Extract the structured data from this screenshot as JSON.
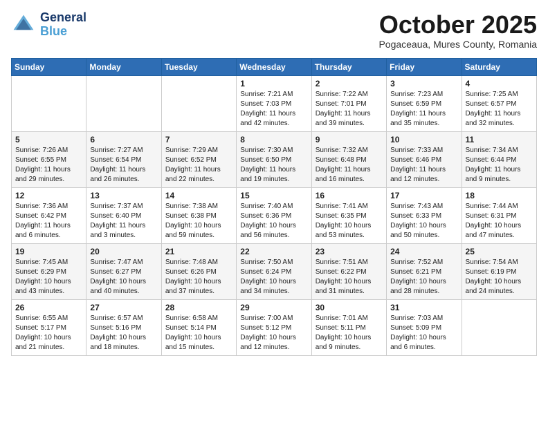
{
  "header": {
    "logo_general": "General",
    "logo_blue": "Blue",
    "month_title": "October 2025",
    "location": "Pogaceaua, Mures County, Romania"
  },
  "days_of_week": [
    "Sunday",
    "Monday",
    "Tuesday",
    "Wednesday",
    "Thursday",
    "Friday",
    "Saturday"
  ],
  "weeks": [
    [
      {
        "day": "",
        "info": ""
      },
      {
        "day": "",
        "info": ""
      },
      {
        "day": "",
        "info": ""
      },
      {
        "day": "1",
        "info": "Sunrise: 7:21 AM\nSunset: 7:03 PM\nDaylight: 11 hours\nand 42 minutes."
      },
      {
        "day": "2",
        "info": "Sunrise: 7:22 AM\nSunset: 7:01 PM\nDaylight: 11 hours\nand 39 minutes."
      },
      {
        "day": "3",
        "info": "Sunrise: 7:23 AM\nSunset: 6:59 PM\nDaylight: 11 hours\nand 35 minutes."
      },
      {
        "day": "4",
        "info": "Sunrise: 7:25 AM\nSunset: 6:57 PM\nDaylight: 11 hours\nand 32 minutes."
      }
    ],
    [
      {
        "day": "5",
        "info": "Sunrise: 7:26 AM\nSunset: 6:55 PM\nDaylight: 11 hours\nand 29 minutes."
      },
      {
        "day": "6",
        "info": "Sunrise: 7:27 AM\nSunset: 6:54 PM\nDaylight: 11 hours\nand 26 minutes."
      },
      {
        "day": "7",
        "info": "Sunrise: 7:29 AM\nSunset: 6:52 PM\nDaylight: 11 hours\nand 22 minutes."
      },
      {
        "day": "8",
        "info": "Sunrise: 7:30 AM\nSunset: 6:50 PM\nDaylight: 11 hours\nand 19 minutes."
      },
      {
        "day": "9",
        "info": "Sunrise: 7:32 AM\nSunset: 6:48 PM\nDaylight: 11 hours\nand 16 minutes."
      },
      {
        "day": "10",
        "info": "Sunrise: 7:33 AM\nSunset: 6:46 PM\nDaylight: 11 hours\nand 12 minutes."
      },
      {
        "day": "11",
        "info": "Sunrise: 7:34 AM\nSunset: 6:44 PM\nDaylight: 11 hours\nand 9 minutes."
      }
    ],
    [
      {
        "day": "12",
        "info": "Sunrise: 7:36 AM\nSunset: 6:42 PM\nDaylight: 11 hours\nand 6 minutes."
      },
      {
        "day": "13",
        "info": "Sunrise: 7:37 AM\nSunset: 6:40 PM\nDaylight: 11 hours\nand 3 minutes."
      },
      {
        "day": "14",
        "info": "Sunrise: 7:38 AM\nSunset: 6:38 PM\nDaylight: 10 hours\nand 59 minutes."
      },
      {
        "day": "15",
        "info": "Sunrise: 7:40 AM\nSunset: 6:36 PM\nDaylight: 10 hours\nand 56 minutes."
      },
      {
        "day": "16",
        "info": "Sunrise: 7:41 AM\nSunset: 6:35 PM\nDaylight: 10 hours\nand 53 minutes."
      },
      {
        "day": "17",
        "info": "Sunrise: 7:43 AM\nSunset: 6:33 PM\nDaylight: 10 hours\nand 50 minutes."
      },
      {
        "day": "18",
        "info": "Sunrise: 7:44 AM\nSunset: 6:31 PM\nDaylight: 10 hours\nand 47 minutes."
      }
    ],
    [
      {
        "day": "19",
        "info": "Sunrise: 7:45 AM\nSunset: 6:29 PM\nDaylight: 10 hours\nand 43 minutes."
      },
      {
        "day": "20",
        "info": "Sunrise: 7:47 AM\nSunset: 6:27 PM\nDaylight: 10 hours\nand 40 minutes."
      },
      {
        "day": "21",
        "info": "Sunrise: 7:48 AM\nSunset: 6:26 PM\nDaylight: 10 hours\nand 37 minutes."
      },
      {
        "day": "22",
        "info": "Sunrise: 7:50 AM\nSunset: 6:24 PM\nDaylight: 10 hours\nand 34 minutes."
      },
      {
        "day": "23",
        "info": "Sunrise: 7:51 AM\nSunset: 6:22 PM\nDaylight: 10 hours\nand 31 minutes."
      },
      {
        "day": "24",
        "info": "Sunrise: 7:52 AM\nSunset: 6:21 PM\nDaylight: 10 hours\nand 28 minutes."
      },
      {
        "day": "25",
        "info": "Sunrise: 7:54 AM\nSunset: 6:19 PM\nDaylight: 10 hours\nand 24 minutes."
      }
    ],
    [
      {
        "day": "26",
        "info": "Sunrise: 6:55 AM\nSunset: 5:17 PM\nDaylight: 10 hours\nand 21 minutes."
      },
      {
        "day": "27",
        "info": "Sunrise: 6:57 AM\nSunset: 5:16 PM\nDaylight: 10 hours\nand 18 minutes."
      },
      {
        "day": "28",
        "info": "Sunrise: 6:58 AM\nSunset: 5:14 PM\nDaylight: 10 hours\nand 15 minutes."
      },
      {
        "day": "29",
        "info": "Sunrise: 7:00 AM\nSunset: 5:12 PM\nDaylight: 10 hours\nand 12 minutes."
      },
      {
        "day": "30",
        "info": "Sunrise: 7:01 AM\nSunset: 5:11 PM\nDaylight: 10 hours\nand 9 minutes."
      },
      {
        "day": "31",
        "info": "Sunrise: 7:03 AM\nSunset: 5:09 PM\nDaylight: 10 hours\nand 6 minutes."
      },
      {
        "day": "",
        "info": ""
      }
    ]
  ]
}
